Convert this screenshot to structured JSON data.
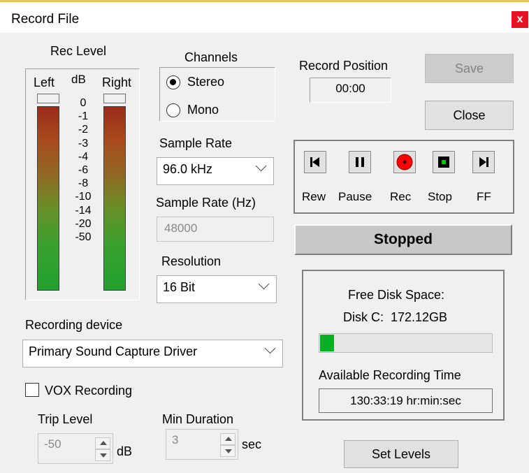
{
  "window": {
    "title": "Record File",
    "close_symbol": "x"
  },
  "rec_level": {
    "heading": "Rec Level",
    "left_label": "Left",
    "db_label": "dB",
    "right_label": "Right",
    "scale": [
      "0",
      "-1",
      "-2",
      "-3",
      "-4",
      "-6",
      "-8",
      "-10",
      "-14",
      "-20",
      "-50"
    ]
  },
  "channels": {
    "heading": "Channels",
    "options": [
      "Stereo",
      "Mono"
    ],
    "selected": "Stereo"
  },
  "sample_rate": {
    "label": "Sample Rate",
    "value": "96.0 kHz"
  },
  "sample_rate_hz": {
    "label": "Sample Rate (Hz)",
    "value": "48000"
  },
  "resolution": {
    "label": "Resolution",
    "value": "16 Bit"
  },
  "record_position": {
    "label": "Record Position",
    "value": "00:00"
  },
  "buttons": {
    "save": "Save",
    "close": "Close",
    "set_levels": "Set Levels"
  },
  "transport": {
    "rew": "Rew",
    "pause": "Pause",
    "rec": "Rec",
    "stop": "Stop",
    "ff": "FF",
    "rec_color": "#ff0000",
    "stop_color": "#00c000"
  },
  "status": "Stopped",
  "disk": {
    "heading": "Free Disk Space:",
    "info": "Disk C:  172.12GB",
    "used_fraction": 0.08,
    "available_label": "Available Recording Time",
    "available_value": "130:33:19 hr:min:sec",
    "bar_color": "#06b025"
  },
  "recording_device": {
    "label": "Recording device",
    "value": "Primary Sound Capture Driver"
  },
  "vox": {
    "label": "VOX Recording",
    "checked": false,
    "trip_level_label": "Trip Level",
    "trip_level_value": "-50",
    "trip_level_unit": "dB",
    "min_duration_label": "Min Duration",
    "min_duration_value": "3",
    "min_duration_unit": "sec"
  }
}
